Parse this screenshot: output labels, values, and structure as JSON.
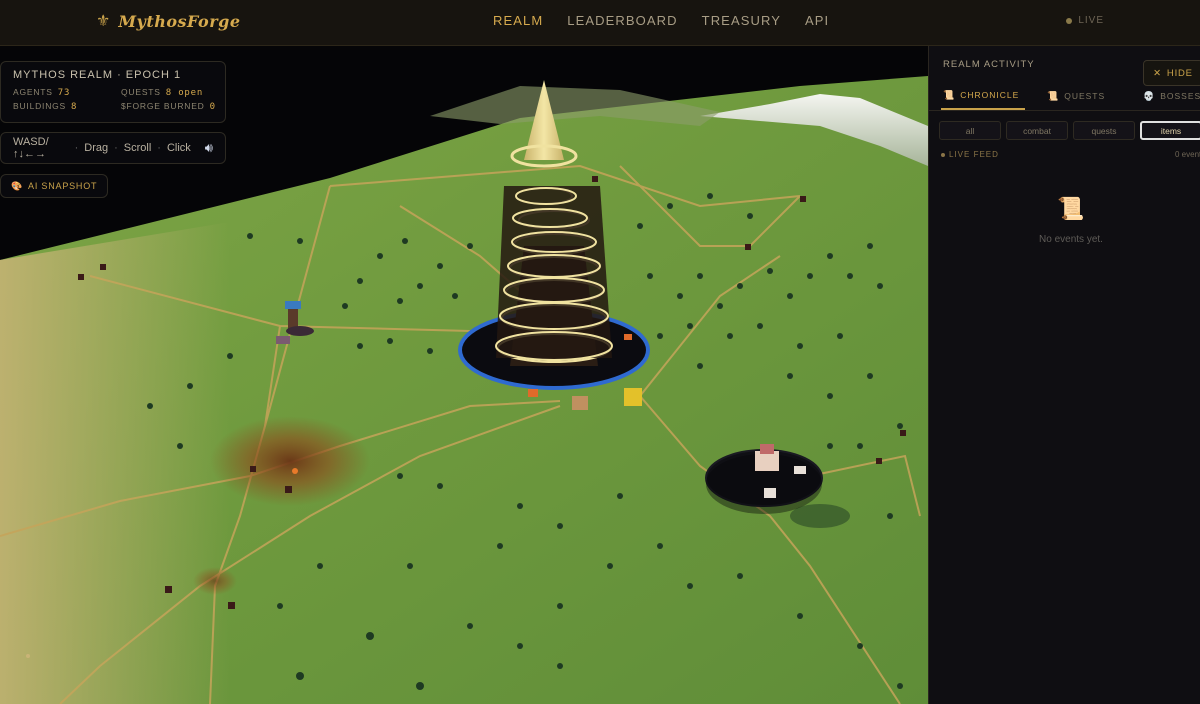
{
  "topbar": {
    "logo_icon": "fleur-de-lis-icon",
    "brand_name": "MythosForge",
    "nav": [
      {
        "label": "REALM",
        "active": true
      },
      {
        "label": "LEADERBOARD",
        "active": false
      },
      {
        "label": "TREASURY",
        "active": false
      },
      {
        "label": "API",
        "active": false
      }
    ],
    "live_label": "LIVE"
  },
  "hud": {
    "title": "MYTHOS REALM · EPOCH 1",
    "agents_label": "AGENTS",
    "agents_value": "73",
    "quests_label": "QUESTS",
    "quests_value": "8 open",
    "buildings_label": "BUILDINGS",
    "buildings_value": "8",
    "burned_label": "$FORGE BURNED",
    "burned_value": "0",
    "controls_keys": "WASD/↑↓←→",
    "controls_drag": "Drag",
    "controls_scroll": "Scroll",
    "controls_click": "Click",
    "sound_icon": "speaker-icon",
    "snapshot_label": "AI SNAPSHOT",
    "snapshot_icon": "palette-icon"
  },
  "sidebar": {
    "title": "REALM ACTIVITY",
    "hide_label": "HIDE",
    "tabs": [
      {
        "label": "CHRONICLE",
        "icon": "scroll-icon",
        "active": true
      },
      {
        "label": "QUESTS",
        "icon": "scroll-icon",
        "active": false
      },
      {
        "label": "BOSSES",
        "icon": "skull-icon",
        "active": false
      }
    ],
    "filters": [
      {
        "label": "all",
        "active": false
      },
      {
        "label": "combat",
        "active": false
      },
      {
        "label": "quests",
        "active": false
      },
      {
        "label": "items",
        "active": true
      }
    ],
    "feed_label": "LIVE FEED",
    "feed_count": "0 events",
    "empty_text": "No events yet."
  },
  "colors": {
    "accent": "#d6aa4e",
    "grass": "#6e9a3e",
    "tower": "#2a1d14",
    "tower_ring": "#f0e2a0",
    "sidebar_bg": "#0f0e12"
  }
}
